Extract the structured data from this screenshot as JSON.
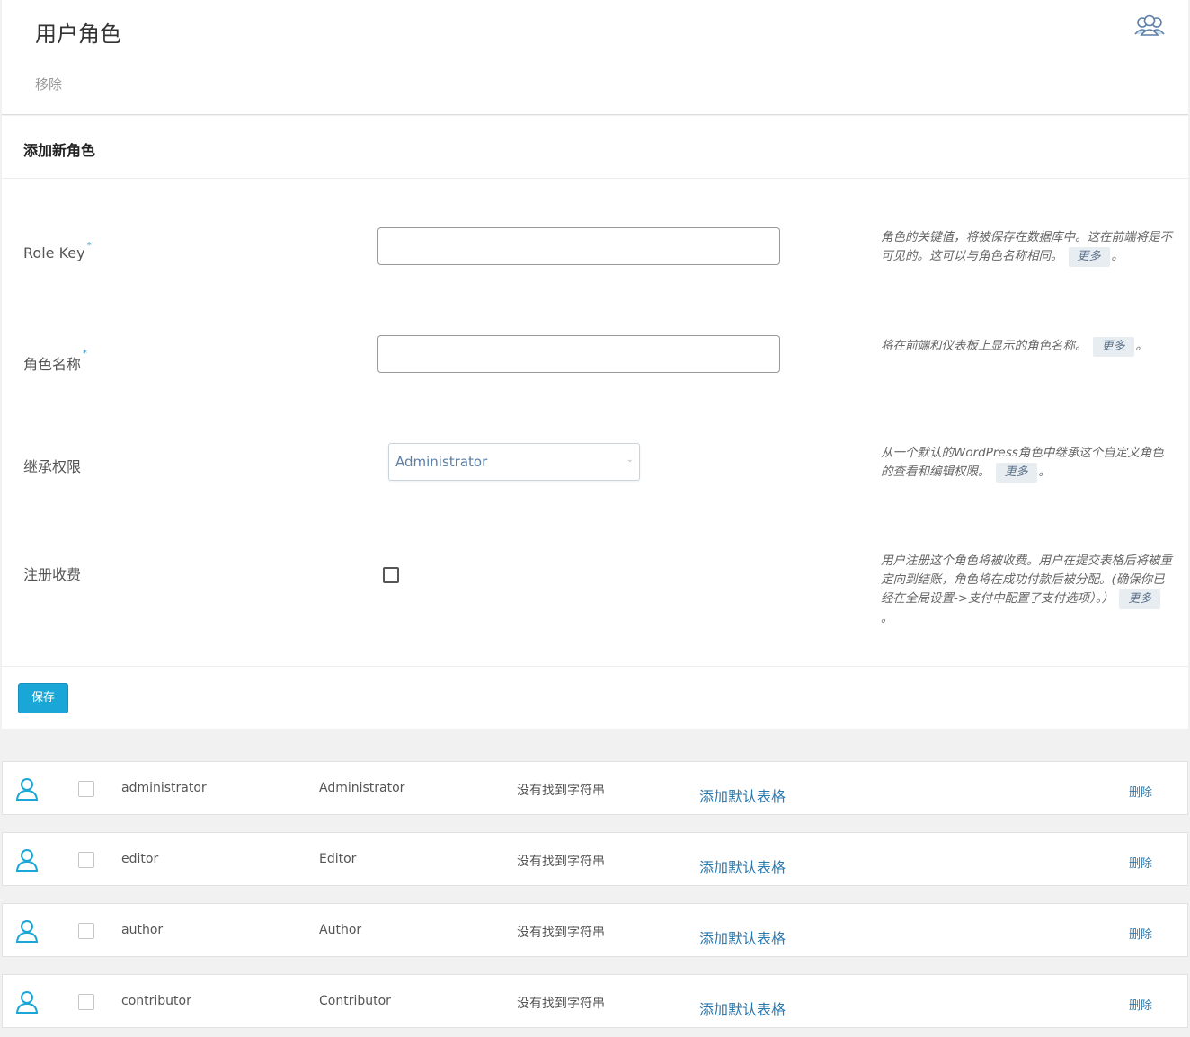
{
  "header": {
    "title": "用户角色",
    "remove_label": "移除"
  },
  "form": {
    "section_title": "添加新角色",
    "fields": [
      {
        "label": "Role Key",
        "required_mark": "*",
        "help": "角色的关键值，将被保存在数据库中。这在前端将是不可见的。这可以与角色名称相同。",
        "more": "更多",
        "suffix": "。"
      },
      {
        "label": "角色名称",
        "required_mark": "*",
        "help": "将在前端和仪表板上显示的角色名称。",
        "more": "更多",
        "suffix": "。"
      },
      {
        "label": "继承权限",
        "select_value": "Administrator",
        "help": "从一个默认的WordPress角色中继承这个自定义角色的查看和编辑权限。",
        "more": "更多",
        "suffix": "。"
      },
      {
        "label": "注册收费",
        "help": "用户注册这个角色将被收费。用户在提交表格后将被重定向到结账，角色将在成功付款后被分配。(确保你已经在全局设置->支付中配置了支付选项）。）",
        "more": "更多",
        "suffix": "。"
      }
    ],
    "save_label": "保存"
  },
  "roles": [
    {
      "key": "administrator",
      "name": "Administrator",
      "status": "没有找到字符串",
      "action": "添加默认表格",
      "delete": "删除"
    },
    {
      "key": "editor",
      "name": "Editor",
      "status": "没有找到字符串",
      "action": "添加默认表格",
      "delete": "删除"
    },
    {
      "key": "author",
      "name": "Author",
      "status": "没有找到字符串",
      "action": "添加默认表格",
      "delete": "删除"
    },
    {
      "key": "contributor",
      "name": "Contributor",
      "status": "没有找到字符串",
      "action": "添加默认表格",
      "delete": "删除"
    }
  ],
  "colors": {
    "accent": "#1aa7d8",
    "link": "#2a7ab0"
  },
  "icons": {
    "header": "users-icon",
    "row": "user-icon"
  }
}
